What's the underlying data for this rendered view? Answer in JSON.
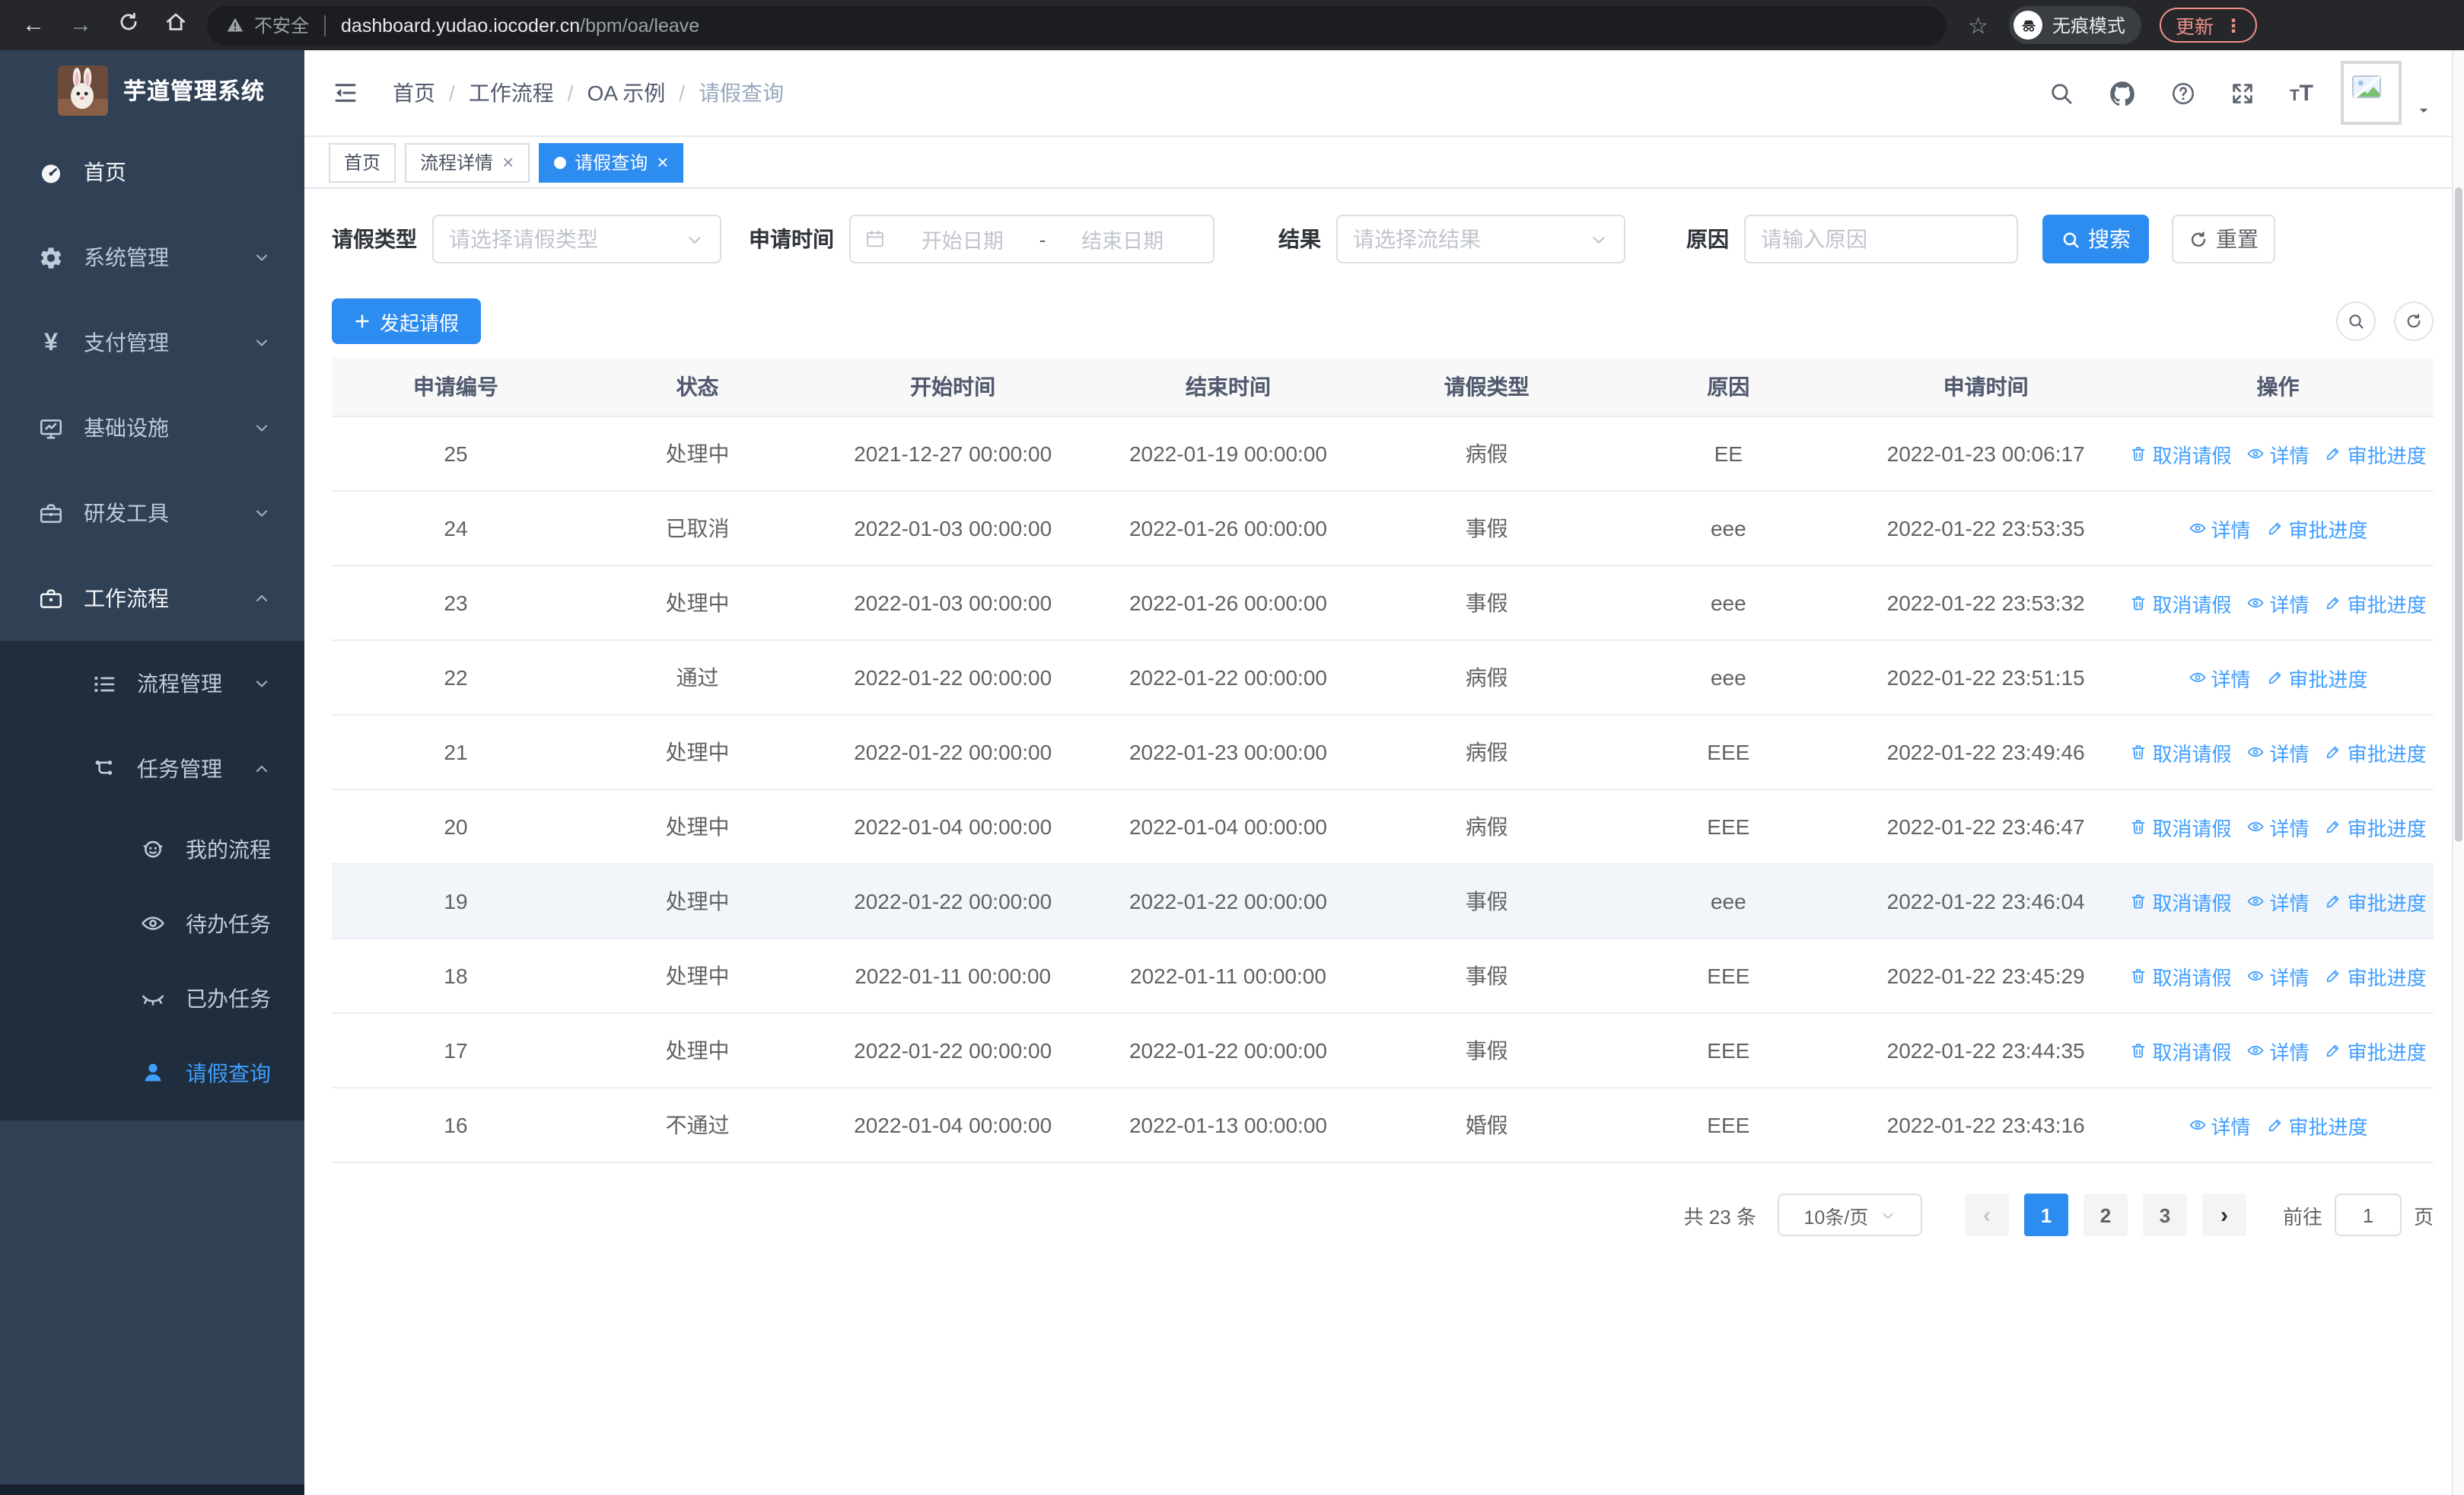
{
  "browser": {
    "security_label": "不安全",
    "url_host": "dashboard.yudao.iocoder.cn",
    "url_path": "/bpm/oa/leave",
    "incognito_label": "无痕模式",
    "update_label": "更新"
  },
  "sidebar": {
    "title": "芋道管理系统",
    "menu": [
      {
        "label": "首页",
        "icon": "dashboard-icon",
        "level": 1,
        "bright": true
      },
      {
        "label": "系统管理",
        "icon": "gear-icon",
        "level": 1,
        "arrow": "down"
      },
      {
        "label": "支付管理",
        "icon": "yen-icon",
        "level": 1,
        "arrow": "down"
      },
      {
        "label": "基础设施",
        "icon": "monitor-icon",
        "level": 1,
        "arrow": "down"
      },
      {
        "label": "研发工具",
        "icon": "toolbox-icon",
        "level": 1,
        "arrow": "down"
      },
      {
        "label": "工作流程",
        "icon": "briefcase-icon",
        "level": 1,
        "arrow": "up",
        "bright": true
      },
      {
        "label": "流程管理",
        "icon": "list-tree-icon",
        "level": 2,
        "arrow": "down",
        "sub": true
      },
      {
        "label": "任务管理",
        "icon": "flow-icon",
        "level": 2,
        "arrow": "up",
        "sub": true
      },
      {
        "label": "我的流程",
        "icon": "robot-icon",
        "level": 3,
        "sub": true
      },
      {
        "label": "待办任务",
        "icon": "eye-icon",
        "level": 3,
        "sub": true
      },
      {
        "label": "已办任务",
        "icon": "eye-closed-icon",
        "level": 3,
        "sub": true
      },
      {
        "label": "请假查询",
        "icon": "user-icon",
        "level": 3,
        "sub": true,
        "active": true
      }
    ]
  },
  "header": {
    "breadcrumb": [
      "首页",
      "工作流程",
      "OA 示例",
      "请假查询"
    ]
  },
  "tabs": [
    {
      "label": "首页"
    },
    {
      "label": "流程详情",
      "closable": true
    },
    {
      "label": "请假查询",
      "closable": true,
      "active": true
    }
  ],
  "filters": {
    "leave_type_label": "请假类型",
    "leave_type_placeholder": "请选择请假类型",
    "apply_time_label": "申请时间",
    "date_start_placeholder": "开始日期",
    "date_separator": "-",
    "date_end_placeholder": "结束日期",
    "result_label": "结果",
    "result_placeholder": "请选择流结果",
    "reason_label": "原因",
    "reason_placeholder": "请输入原因",
    "search_label": "搜索",
    "reset_label": "重置"
  },
  "toolbar": {
    "create_label": "发起请假"
  },
  "table": {
    "columns": [
      "申请编号",
      "状态",
      "开始时间",
      "结束时间",
      "请假类型",
      "原因",
      "申请时间",
      "操作"
    ],
    "ops_labels": {
      "cancel": "取消请假",
      "detail": "详情",
      "progress": "审批进度"
    },
    "rows": [
      {
        "id": "25",
        "status": "处理中",
        "start": "2021-12-27 00:00:00",
        "end": "2022-01-19 00:00:00",
        "type": "病假",
        "reason": "EE",
        "applied": "2022-01-23 00:06:17",
        "ops": [
          "cancel",
          "detail",
          "progress"
        ]
      },
      {
        "id": "24",
        "status": "已取消",
        "start": "2022-01-03 00:00:00",
        "end": "2022-01-26 00:00:00",
        "type": "事假",
        "reason": "eee",
        "applied": "2022-01-22 23:53:35",
        "ops": [
          "detail",
          "progress"
        ]
      },
      {
        "id": "23",
        "status": "处理中",
        "start": "2022-01-03 00:00:00",
        "end": "2022-01-26 00:00:00",
        "type": "事假",
        "reason": "eee",
        "applied": "2022-01-22 23:53:32",
        "ops": [
          "cancel",
          "detail",
          "progress"
        ]
      },
      {
        "id": "22",
        "status": "通过",
        "start": "2022-01-22 00:00:00",
        "end": "2022-01-22 00:00:00",
        "type": "病假",
        "reason": "eee",
        "applied": "2022-01-22 23:51:15",
        "ops": [
          "detail",
          "progress"
        ]
      },
      {
        "id": "21",
        "status": "处理中",
        "start": "2022-01-22 00:00:00",
        "end": "2022-01-23 00:00:00",
        "type": "病假",
        "reason": "EEE",
        "applied": "2022-01-22 23:49:46",
        "ops": [
          "cancel",
          "detail",
          "progress"
        ]
      },
      {
        "id": "20",
        "status": "处理中",
        "start": "2022-01-04 00:00:00",
        "end": "2022-01-04 00:00:00",
        "type": "病假",
        "reason": "EEE",
        "applied": "2022-01-22 23:46:47",
        "ops": [
          "cancel",
          "detail",
          "progress"
        ]
      },
      {
        "id": "19",
        "status": "处理中",
        "start": "2022-01-22 00:00:00",
        "end": "2022-01-22 00:00:00",
        "type": "事假",
        "reason": "eee",
        "applied": "2022-01-22 23:46:04",
        "ops": [
          "cancel",
          "detail",
          "progress"
        ],
        "highlighted": true
      },
      {
        "id": "18",
        "status": "处理中",
        "start": "2022-01-11 00:00:00",
        "end": "2022-01-11 00:00:00",
        "type": "事假",
        "reason": "EEE",
        "applied": "2022-01-22 23:45:29",
        "ops": [
          "cancel",
          "detail",
          "progress"
        ]
      },
      {
        "id": "17",
        "status": "处理中",
        "start": "2022-01-22 00:00:00",
        "end": "2022-01-22 00:00:00",
        "type": "事假",
        "reason": "EEE",
        "applied": "2022-01-22 23:44:35",
        "ops": [
          "cancel",
          "detail",
          "progress"
        ]
      },
      {
        "id": "16",
        "status": "不通过",
        "start": "2022-01-04 00:00:00",
        "end": "2022-01-13 00:00:00",
        "type": "婚假",
        "reason": "EEE",
        "applied": "2022-01-22 23:43:16",
        "ops": [
          "detail",
          "progress"
        ]
      }
    ]
  },
  "pagination": {
    "total_label": "共 23 条",
    "page_size_label": "10条/页",
    "pages": [
      "1",
      "2",
      "3"
    ],
    "active_page": "1",
    "goto_label": "前往",
    "goto_value": "1",
    "page_unit_label": "页"
  },
  "colors": {
    "primary": "#2d8cf0",
    "link": "#409eff",
    "sidebar_bg": "#304156",
    "submenu_bg": "#1f2d3d",
    "active_menu": "#409eff",
    "update_accent": "#ef8f88"
  }
}
